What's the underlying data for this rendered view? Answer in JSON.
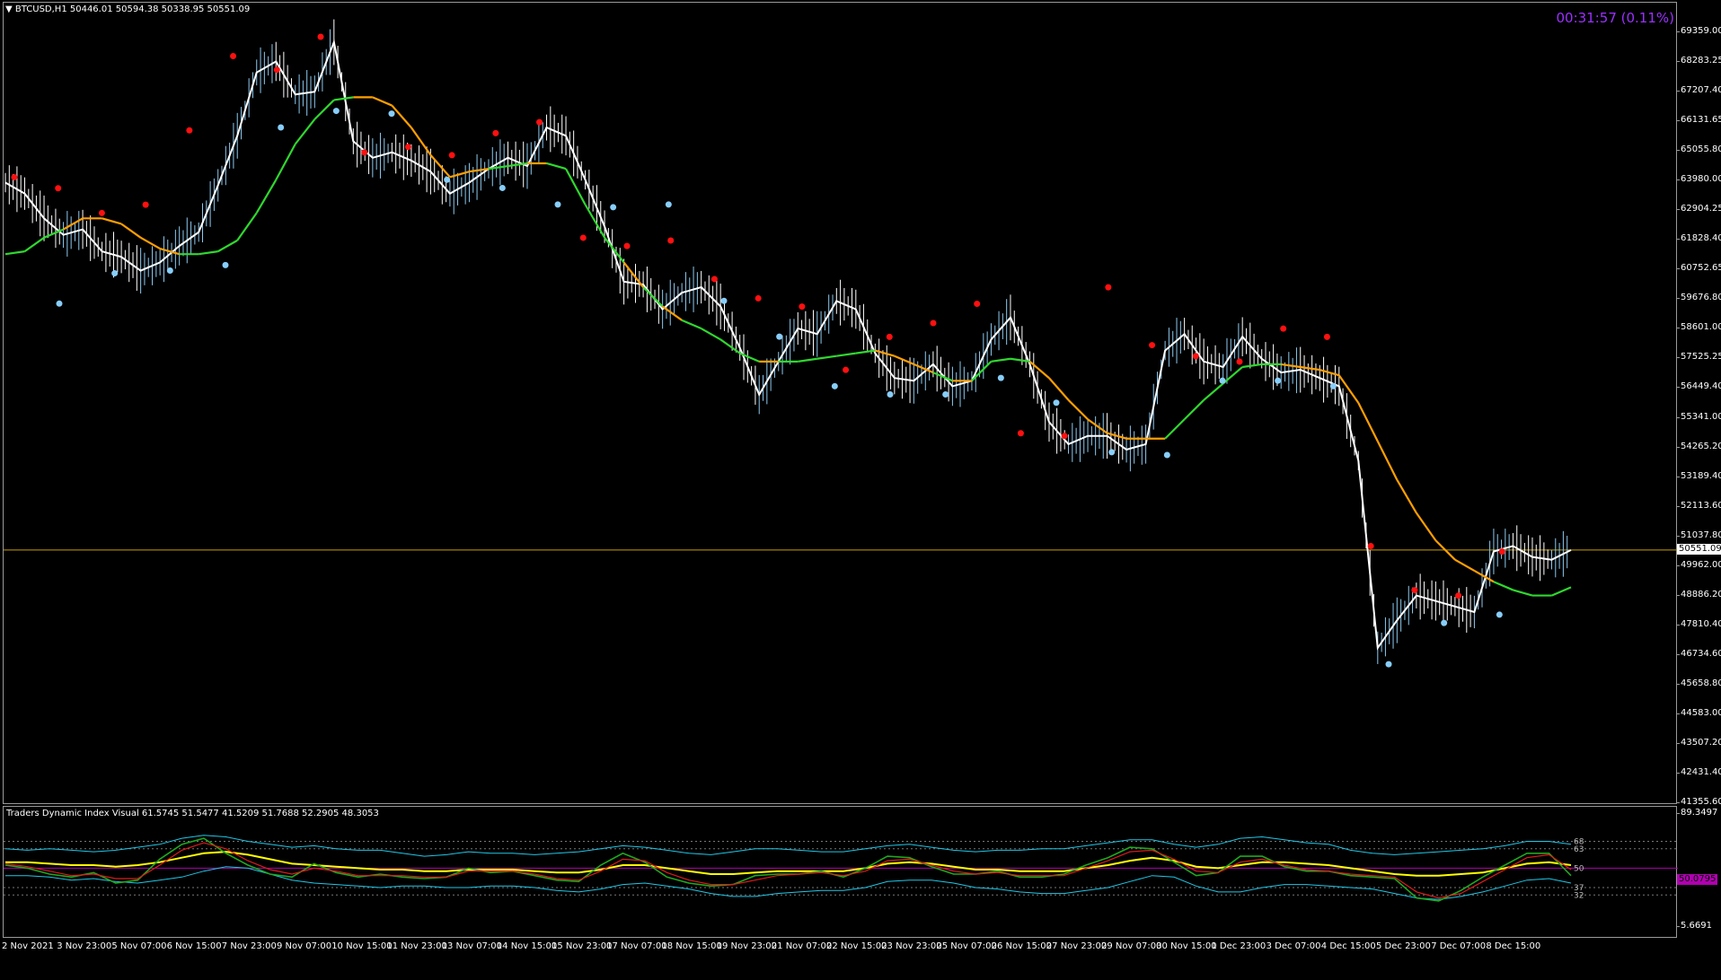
{
  "symbol_header": {
    "caret": "▼",
    "text": "BTCUSD,H1  50446.01 50594.38 50338.95 50551.09"
  },
  "timer": {
    "text": "00:31:57 (0.11%)",
    "color": "#9b30ff"
  },
  "current_price": {
    "value": 50551.09,
    "label": "50551.09",
    "line_color": "#c8a000"
  },
  "price_axis": {
    "labels": [
      "69359.00",
      "68283.25",
      "67207.40",
      "66131.65",
      "65055.80",
      "63980.00",
      "62904.25",
      "61828.40",
      "60752.65",
      "59676.80",
      "58601.00",
      "57525.25",
      "56449.40",
      "55341.00",
      "54265.20",
      "53189.40",
      "52113.60",
      "51037.80",
      "49962.00",
      "48886.20",
      "47810.40",
      "46734.60",
      "45658.80",
      "44583.00",
      "43507.20",
      "42431.40",
      "41355.60"
    ]
  },
  "indicator": {
    "title": "Traders Dynamic Index Visual 61.5745 51.5477 41.5209 51.7688 52.2905 48.3053",
    "axis_top": "89.3497",
    "axis_bottom": "5.6691",
    "levels": [
      "68",
      "63",
      "50",
      "37",
      "32"
    ],
    "current_label": "50.0795",
    "colors": {
      "upper_band": "#1ec8e8",
      "lower_band": "#1ec8e8",
      "middle": "#ffff00",
      "rsi_price": "#1fa81f",
      "signal": "#e01a1a",
      "mid_level": "#b000b0"
    }
  },
  "time_axis": {
    "labels": [
      "2 Nov 2021",
      "3 Nov 23:00",
      "5 Nov 07:00",
      "6 Nov 15:00",
      "7 Nov 23:00",
      "9 Nov 07:00",
      "10 Nov 15:00",
      "11 Nov 23:00",
      "13 Nov 07:00",
      "14 Nov 15:00",
      "15 Nov 23:00",
      "17 Nov 07:00",
      "18 Nov 15:00",
      "19 Nov 23:00",
      "21 Nov 07:00",
      "22 Nov 15:00",
      "23 Nov 23:00",
      "25 Nov 07:00",
      "26 Nov 15:00",
      "27 Nov 23:00",
      "29 Nov 07:00",
      "30 Nov 15:00",
      "1 Dec 23:00",
      "3 Dec 07:00",
      "4 Dec 15:00",
      "5 Dec 23:00",
      "7 Dec 07:00",
      "8 Dec 15:00"
    ]
  },
  "chart_data": {
    "type": "line",
    "series": [
      {
        "values": [
          63900,
          63500,
          62600,
          62000,
          62200,
          61400,
          61200,
          60700,
          61000,
          61600,
          62100,
          63800,
          65600,
          67900,
          68300,
          67100,
          67200,
          69000,
          65400,
          64800,
          65000,
          64700,
          64300,
          63500,
          63900,
          64400,
          64800,
          64500,
          65900,
          65600,
          64000,
          62300,
          60300,
          60200,
          59300,
          59900,
          60100,
          59400,
          57900,
          56200,
          57400,
          58600,
          58400,
          59600,
          59300,
          57700,
          56800,
          56700,
          57300,
          56500,
          56700,
          58200,
          59000,
          57300,
          55200,
          54400,
          54700,
          54700,
          54200,
          54400,
          57800,
          58400,
          57400,
          57200,
          58300,
          57500,
          57000,
          57100,
          56800,
          56500,
          53800,
          47000,
          48000,
          48900,
          48700,
          48500,
          48300,
          50500,
          50700,
          50300,
          50200,
          50551
        ]
      },
      {
        "values": [
          61300,
          61400,
          61900,
          62200,
          62600,
          62600,
          62400,
          61900,
          61500,
          61300,
          61300,
          61400,
          61800,
          62800,
          64000,
          65300,
          66200,
          66900,
          67000,
          67000,
          66700,
          65900,
          64900,
          64100,
          64300,
          64400,
          64500,
          64600,
          64600,
          64400,
          63100,
          61900,
          61000,
          60100,
          59400,
          58900,
          58600,
          58200,
          57700,
          57400,
          57400,
          57400,
          57500,
          57600,
          57700,
          57800,
          57600,
          57300,
          57000,
          56700,
          56700,
          57400,
          57500,
          57400,
          56800,
          56000,
          55300,
          54800,
          54600,
          54600,
          54600,
          55300,
          56000,
          56600,
          57200,
          57300,
          57300,
          57200,
          57100,
          56900,
          55900,
          54500,
          53100,
          51900,
          50900,
          50200,
          49800,
          49400,
          49100,
          48900,
          48900,
          49200
        ]
      }
    ],
    "signals_down": [
      63900,
      63500,
      62600,
      62900,
      65600,
      68300,
      67800,
      69000,
      64800,
      65000,
      64700,
      65500,
      65900,
      61700,
      61400,
      61600,
      60200,
      59500,
      59200,
      56900,
      58100,
      58600,
      59300,
      54600,
      54500,
      59900,
      57800,
      57400,
      57200,
      58400,
      58100,
      50500,
      48900,
      48700,
      50300
    ],
    "signals_up": [
      59700,
      60800,
      60900,
      61100,
      66100,
      66700,
      66600,
      64200,
      63900,
      63300,
      63200,
      63300,
      59800,
      58500,
      56700,
      56400,
      56400,
      57000,
      56100,
      54300,
      54200,
      56900,
      56900,
      56700,
      46600,
      48100,
      48400
    ],
    "indicator_series": [
      {
        "name": "upper_band",
        "values": [
          63,
          62,
          63,
          62,
          61,
          62,
          64,
          66,
          70,
          72,
          71,
          68,
          66,
          64,
          65,
          63,
          62,
          62,
          60,
          58,
          59,
          61,
          60,
          60,
          59,
          60,
          61,
          63,
          65,
          64,
          62,
          60,
          59,
          61,
          63,
          63,
          62,
          61,
          61,
          63,
          65,
          66,
          64,
          62,
          61,
          62,
          62,
          63,
          63,
          65,
          67,
          69,
          69,
          66,
          64,
          66,
          70,
          71,
          69,
          67,
          66,
          62,
          60,
          59,
          60,
          61,
          62,
          63,
          65,
          68,
          68,
          66
        ]
      },
      {
        "name": "middle",
        "values": [
          54,
          54,
          53,
          52,
          52,
          51,
          52,
          54,
          57,
          60,
          61,
          59,
          56,
          53,
          52,
          51,
          50,
          49,
          49,
          48,
          48,
          49,
          49,
          49,
          48,
          47,
          47,
          49,
          52,
          52,
          50,
          48,
          46,
          46,
          47,
          48,
          48,
          48,
          48,
          50,
          53,
          54,
          53,
          51,
          49,
          49,
          48,
          48,
          48,
          50,
          52,
          55,
          57,
          55,
          51,
          50,
          52,
          54,
          54,
          53,
          52,
          50,
          48,
          46,
          45,
          45,
          46,
          47,
          50,
          53,
          54,
          52
        ]
      },
      {
        "name": "lower_band",
        "values": [
          45,
          45,
          44,
          42,
          43,
          41,
          40,
          42,
          44,
          48,
          51,
          50,
          46,
          42,
          40,
          39,
          38,
          37,
          38,
          38,
          37,
          37,
          38,
          38,
          37,
          35,
          34,
          36,
          39,
          40,
          38,
          36,
          33,
          31,
          31,
          33,
          34,
          35,
          35,
          37,
          41,
          42,
          42,
          40,
          37,
          36,
          34,
          33,
          33,
          35,
          37,
          41,
          45,
          44,
          38,
          34,
          34,
          37,
          39,
          39,
          38,
          37,
          36,
          33,
          30,
          29,
          31,
          34,
          38,
          42,
          43,
          40
        ]
      },
      {
        "name": "rsi_price",
        "values": [
          52,
          50,
          46,
          44,
          47,
          40,
          42,
          56,
          66,
          70,
          60,
          52,
          46,
          44,
          53,
          47,
          44,
          46,
          44,
          43,
          44,
          50,
          47,
          48,
          45,
          42,
          41,
          52,
          60,
          54,
          44,
          40,
          38,
          39,
          45,
          46,
          46,
          48,
          44,
          50,
          58,
          57,
          51,
          46,
          46,
          48,
          44,
          44,
          46,
          52,
          57,
          64,
          63,
          54,
          45,
          47,
          58,
          58,
          51,
          48,
          48,
          45,
          44,
          43,
          30,
          28,
          35,
          44,
          52,
          60,
          60,
          45
        ]
      },
      {
        "name": "signal",
        "values": [
          53,
          51,
          48,
          45,
          46,
          43,
          43,
          52,
          62,
          67,
          63,
          55,
          49,
          46,
          50,
          48,
          45,
          45,
          45,
          44,
          44,
          48,
          48,
          48,
          46,
          43,
          42,
          48,
          56,
          55,
          47,
          42,
          39,
          39,
          42,
          45,
          46,
          47,
          45,
          48,
          55,
          56,
          52,
          48,
          46,
          47,
          45,
          45,
          45,
          50,
          55,
          61,
          62,
          56,
          48,
          47,
          54,
          56,
          52,
          49,
          48,
          46,
          45,
          44,
          34,
          30,
          33,
          41,
          49,
          57,
          59,
          49
        ]
      }
    ],
    "indicator_range": [
      5.6691,
      89.3497
    ],
    "ylim": [
      41355.6,
      69359.0
    ],
    "price_axis_labels": "see price_axis.labels",
    "x_labels": "see time_axis.labels"
  }
}
